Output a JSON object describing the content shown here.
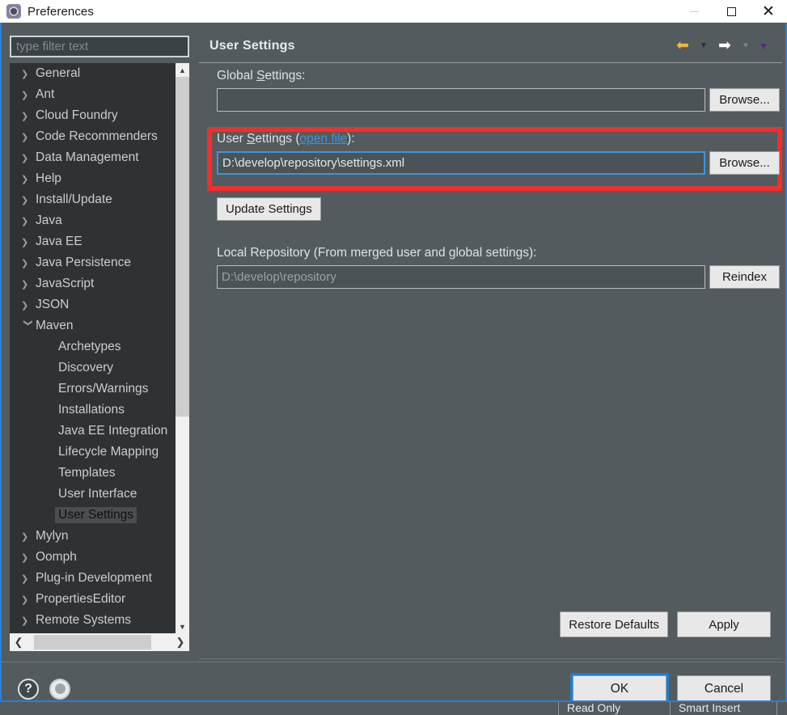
{
  "window": {
    "title": "Preferences",
    "icon": "gear-icon",
    "minimize_label": "—",
    "maximize_label": "□",
    "close_label": "✕"
  },
  "sidebar": {
    "filter_placeholder": "type filter text",
    "filter_value": "",
    "items": [
      {
        "label": "General",
        "level": 0,
        "expandable": true,
        "expanded": false,
        "selected": false
      },
      {
        "label": "Ant",
        "level": 0,
        "expandable": true,
        "expanded": false,
        "selected": false
      },
      {
        "label": "Cloud Foundry",
        "level": 0,
        "expandable": true,
        "expanded": false,
        "selected": false
      },
      {
        "label": "Code Recommenders",
        "level": 0,
        "expandable": true,
        "expanded": false,
        "selected": false
      },
      {
        "label": "Data Management",
        "level": 0,
        "expandable": true,
        "expanded": false,
        "selected": false
      },
      {
        "label": "Help",
        "level": 0,
        "expandable": true,
        "expanded": false,
        "selected": false
      },
      {
        "label": "Install/Update",
        "level": 0,
        "expandable": true,
        "expanded": false,
        "selected": false
      },
      {
        "label": "Java",
        "level": 0,
        "expandable": true,
        "expanded": false,
        "selected": false
      },
      {
        "label": "Java EE",
        "level": 0,
        "expandable": true,
        "expanded": false,
        "selected": false
      },
      {
        "label": "Java Persistence",
        "level": 0,
        "expandable": true,
        "expanded": false,
        "selected": false
      },
      {
        "label": "JavaScript",
        "level": 0,
        "expandable": true,
        "expanded": false,
        "selected": false
      },
      {
        "label": "JSON",
        "level": 0,
        "expandable": true,
        "expanded": false,
        "selected": false
      },
      {
        "label": "Maven",
        "level": 0,
        "expandable": true,
        "expanded": true,
        "selected": false
      },
      {
        "label": "Archetypes",
        "level": 1,
        "expandable": false,
        "expanded": false,
        "selected": false
      },
      {
        "label": "Discovery",
        "level": 1,
        "expandable": false,
        "expanded": false,
        "selected": false
      },
      {
        "label": "Errors/Warnings",
        "level": 1,
        "expandable": false,
        "expanded": false,
        "selected": false
      },
      {
        "label": "Installations",
        "level": 1,
        "expandable": false,
        "expanded": false,
        "selected": false
      },
      {
        "label": "Java EE Integration",
        "level": 1,
        "expandable": false,
        "expanded": false,
        "selected": false
      },
      {
        "label": "Lifecycle Mapping",
        "level": 1,
        "expandable": false,
        "expanded": false,
        "selected": false
      },
      {
        "label": "Templates",
        "level": 1,
        "expandable": false,
        "expanded": false,
        "selected": false
      },
      {
        "label": "User Interface",
        "level": 1,
        "expandable": false,
        "expanded": false,
        "selected": false
      },
      {
        "label": "User Settings",
        "level": 1,
        "expandable": false,
        "expanded": false,
        "selected": true
      },
      {
        "label": "Mylyn",
        "level": 0,
        "expandable": true,
        "expanded": false,
        "selected": false
      },
      {
        "label": "Oomph",
        "level": 0,
        "expandable": true,
        "expanded": false,
        "selected": false
      },
      {
        "label": "Plug-in Development",
        "level": 0,
        "expandable": true,
        "expanded": false,
        "selected": false
      },
      {
        "label": "PropertiesEditor",
        "level": 0,
        "expandable": true,
        "expanded": false,
        "selected": false
      },
      {
        "label": "Remote Systems",
        "level": 0,
        "expandable": true,
        "expanded": false,
        "selected": false
      }
    ],
    "scroll_up_icon": "chevron-up-icon",
    "scroll_down_icon": "chevron-down-icon",
    "scroll_left_icon": "chevron-left-icon",
    "scroll_right_icon": "chevron-right-icon"
  },
  "page": {
    "title": "User Settings",
    "nav": {
      "back_icon": "arrow-left-icon",
      "back_menu_icon": "caret-down-icon",
      "forward_icon": "arrow-right-icon",
      "forward_menu_icon": "caret-down-icon",
      "overflow_icon": "caret-down-icon"
    },
    "global_settings": {
      "label_pre": "Global ",
      "label_mnemonic": "S",
      "label_post": "ettings:",
      "value": "",
      "placeholder": "",
      "browse_label": "Browse..."
    },
    "user_settings": {
      "label_pre": "User ",
      "label_mnemonic": "S",
      "label_mid": "ettings (",
      "link_label": "open file",
      "label_post": "):",
      "value": "D:\\develop\\repository\\settings.xml",
      "browse_label": "Browse...",
      "highlight_color": "#f42d2d"
    },
    "update_settings_label": "Update Settings",
    "local_repository": {
      "label": "Local Repository (From merged user and global settings):",
      "value": "D:\\develop\\repository",
      "reindex_label": "Reindex"
    },
    "restore_defaults_label": "Restore Defaults",
    "apply_label": "Apply"
  },
  "footer": {
    "help_icon": "question-mark-icon",
    "tray_icon": "show-tray-icon",
    "ok_label": "OK",
    "cancel_label": "Cancel"
  },
  "statusbar": {
    "cell1": "Read Only",
    "cell2": "Smart Insert"
  },
  "colors": {
    "dialog_bg": "#535b5e",
    "tree_bg": "#2f3234",
    "accent_blue": "#2b7fd4",
    "link_blue": "#3b95e0",
    "highlight_red": "#f42d2d",
    "back_arrow": "#f0b63b"
  }
}
